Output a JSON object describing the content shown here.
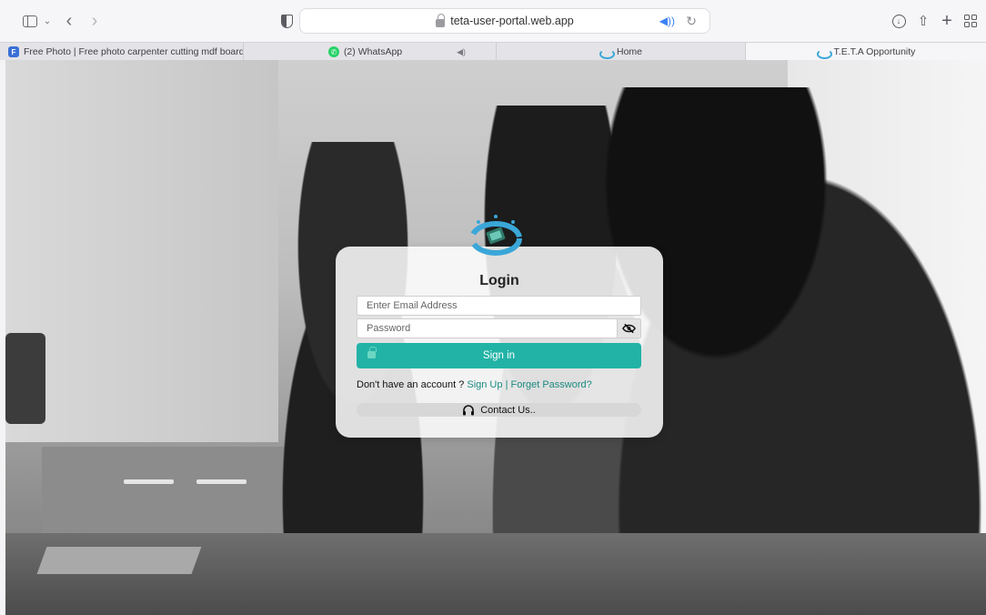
{
  "browser": {
    "url": "teta-user-portal.web.app",
    "tabs": [
      {
        "title": "Free Photo | Free photo carpenter cutting mdf board in..."
      },
      {
        "title": "(2) WhatsApp"
      },
      {
        "title": "Home"
      },
      {
        "title": "T.E.T.A Opportunity"
      }
    ]
  },
  "login": {
    "title": "Login",
    "email_placeholder": "Enter Email Address",
    "password_placeholder": "Password",
    "sign_in_label": "Sign in",
    "no_account_text": "Don't have an account ?",
    "sign_up_link": "Sign Up",
    "separator": "|",
    "forgot_link": "Forget Password?",
    "contact_label": "Contact Us.."
  },
  "colors": {
    "accent": "#22b3a6",
    "link": "#1a8a80"
  }
}
